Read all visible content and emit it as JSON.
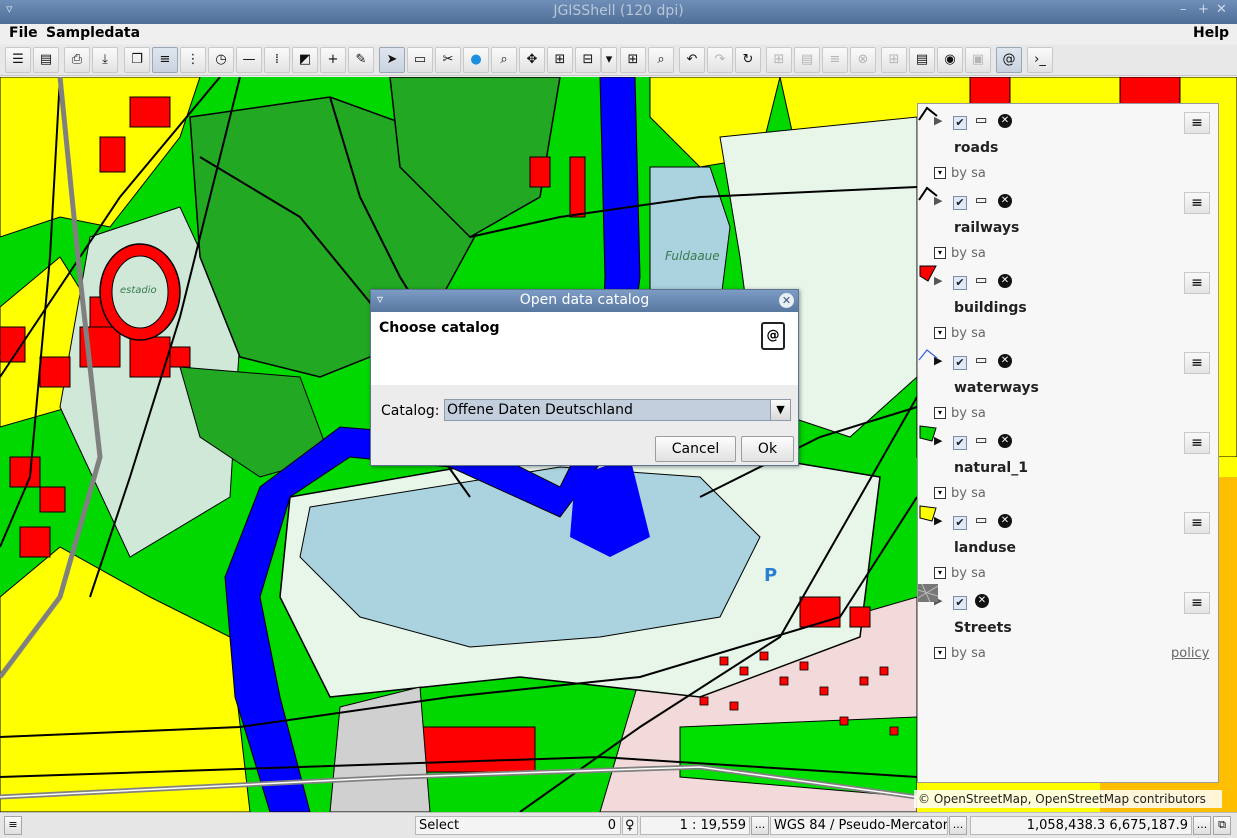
{
  "window": {
    "title": "JGISShell (120 dpi)"
  },
  "menu": {
    "file": "File",
    "sampledata": "Sampledata",
    "help": "Help"
  },
  "toolbar": {
    "icons": [
      "list-icon",
      "table-icon",
      "print-icon",
      "download-icon",
      "windows-icon",
      "menu-icon",
      "more-icon",
      "clock-icon",
      "minus-icon",
      "grid-dots-icon",
      "layers-icon",
      "plus-icon",
      "edit-icon",
      "pointer-icon",
      "comment-icon",
      "scissors-icon",
      "refresh-icon",
      "zoom-area-icon",
      "pan-icon",
      "zoom-in-icon",
      "zoom-out-icon",
      "dropdown-icon",
      "grid-icon",
      "search-icon",
      "undo-icon",
      "redo-icon",
      "reload-icon"
    ]
  },
  "map": {
    "attribution": "© OpenStreetMap, OpenStreetMap contributors"
  },
  "layers": [
    {
      "name": "roads",
      "owner": "by sa",
      "icon": "road-icon"
    },
    {
      "name": "railways",
      "owner": "by sa",
      "icon": "railway-icon"
    },
    {
      "name": "buildings",
      "owner": "by sa",
      "icon": "building-icon"
    },
    {
      "name": "waterways",
      "owner": "by sa",
      "icon": "waterway-icon"
    },
    {
      "name": "natural_1",
      "owner": "by sa",
      "icon": "natural-icon"
    },
    {
      "name": "landuse",
      "owner": "by sa",
      "icon": "landuse-icon"
    },
    {
      "name": "Streets",
      "owner": "by sa",
      "icon": "raster-icon",
      "link": "policy"
    }
  ],
  "dialog": {
    "title": "Open data catalog",
    "heading": "Choose catalog",
    "catalog_label": "Catalog:",
    "catalog_value": "Offene Daten Deutschland",
    "cancel": "Cancel",
    "ok": "Ok"
  },
  "status": {
    "mode": "Select",
    "count": "0",
    "scale": "1 : 19,559",
    "crs": "WGS 84 / Pseudo-Mercator",
    "coords": "1,058,438.3 6,675,187.9",
    "more": "..."
  },
  "colors": {
    "park": "#00d800",
    "dark_green": "#22a822",
    "water": "#0000ff",
    "lake": "#aad3df",
    "building": "#ff0000",
    "residential": "#ffff00"
  }
}
